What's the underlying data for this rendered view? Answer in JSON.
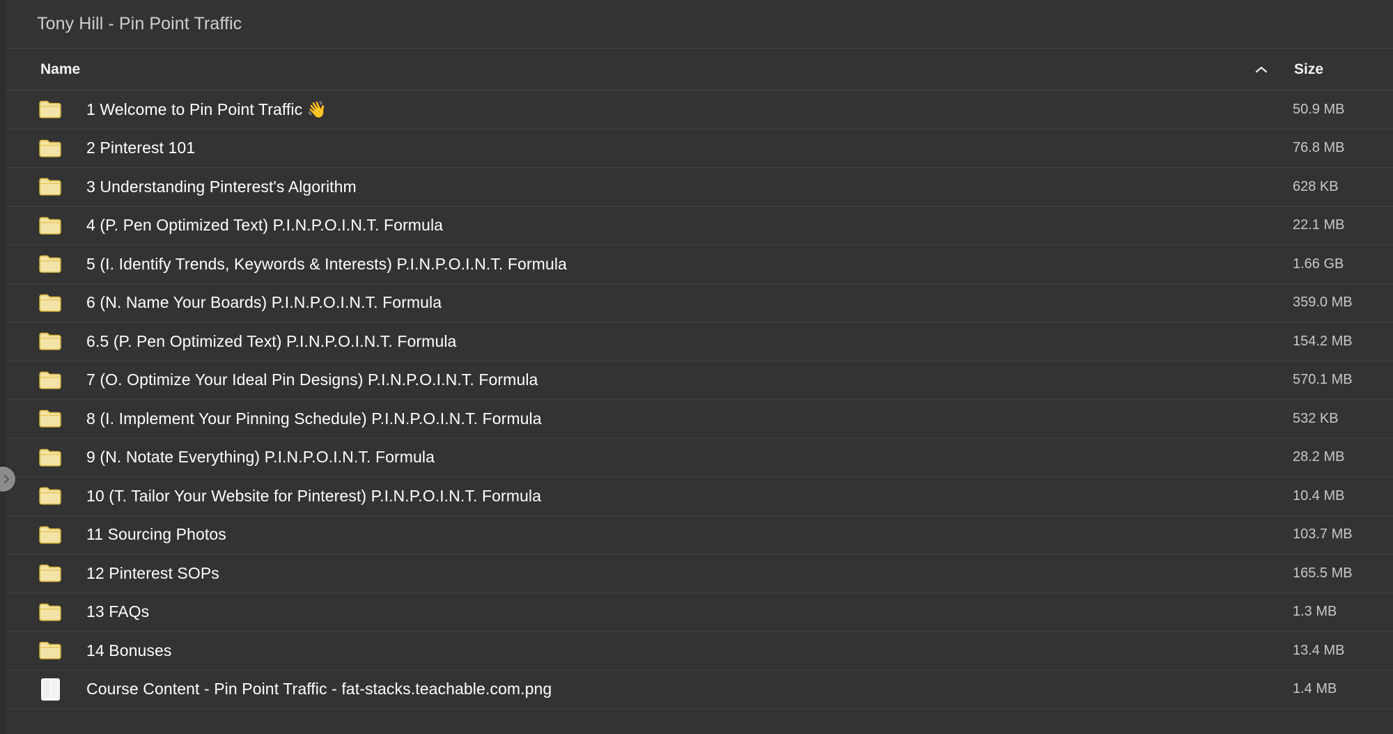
{
  "window": {
    "title": "Tony Hill - Pin Point Traffic"
  },
  "columns": {
    "name_label": "Name",
    "size_label": "Size",
    "sort_column": "Name",
    "sort_direction": "ascending",
    "sort_icon": "chevron-up-icon"
  },
  "sidebar_handle": {
    "icon": "chevron-right-icon"
  },
  "colors": {
    "background": "#333333",
    "row_divider": "#414141",
    "header_divider": "#4a4a4a",
    "text_primary": "#ffffff",
    "text_secondary": "#c8c8c8",
    "title_text": "#cfcfcf",
    "folder_fill": "#f2e3a8",
    "folder_stroke": "#e0bd44",
    "handle_fill": "#8c8c8c"
  },
  "files": [
    {
      "name": "1 Welcome to Pin Point Traffic 👋",
      "size": "50.9 MB",
      "kind": "folder",
      "icon": "folder-icon"
    },
    {
      "name": "2 Pinterest 101",
      "size": "76.8 MB",
      "kind": "folder",
      "icon": "folder-icon"
    },
    {
      "name": "3 Understanding Pinterest's Algorithm",
      "size": "628 KB",
      "kind": "folder",
      "icon": "folder-icon"
    },
    {
      "name": "4 (P. Pen Optimized Text) P.I.N.P.O.I.N.T. Formula",
      "size": "22.1 MB",
      "kind": "folder",
      "icon": "folder-icon"
    },
    {
      "name": "5 (I. Identify Trends, Keywords & Interests) P.I.N.P.O.I.N.T. Formula",
      "size": "1.66 GB",
      "kind": "folder",
      "icon": "folder-icon"
    },
    {
      "name": "6 (N. Name Your Boards) P.I.N.P.O.I.N.T. Formula",
      "size": "359.0 MB",
      "kind": "folder",
      "icon": "folder-icon"
    },
    {
      "name": "6.5 (P. Pen Optimized Text) P.I.N.P.O.I.N.T. Formula",
      "size": "154.2 MB",
      "kind": "folder",
      "icon": "folder-icon"
    },
    {
      "name": "7 (O. Optimize Your Ideal Pin Designs) P.I.N.P.O.I.N.T. Formula",
      "size": "570.1 MB",
      "kind": "folder",
      "icon": "folder-icon"
    },
    {
      "name": "8 (I. Implement Your Pinning Schedule) P.I.N.P.O.I.N.T. Formula",
      "size": "532 KB",
      "kind": "folder",
      "icon": "folder-icon"
    },
    {
      "name": "9 (N. Notate Everything) P.I.N.P.O.I.N.T. Formula",
      "size": "28.2 MB",
      "kind": "folder",
      "icon": "folder-icon"
    },
    {
      "name": "10 (T. Tailor Your Website for Pinterest) P.I.N.P.O.I.N.T. Formula",
      "size": "10.4 MB",
      "kind": "folder",
      "icon": "folder-icon"
    },
    {
      "name": "11 Sourcing Photos",
      "size": "103.7 MB",
      "kind": "folder",
      "icon": "folder-icon"
    },
    {
      "name": "12 Pinterest SOPs",
      "size": "165.5 MB",
      "kind": "folder",
      "icon": "folder-icon"
    },
    {
      "name": "13 FAQs",
      "size": "1.3 MB",
      "kind": "folder",
      "icon": "folder-icon"
    },
    {
      "name": "14 Bonuses",
      "size": "13.4 MB",
      "kind": "folder",
      "icon": "folder-icon"
    },
    {
      "name": "Course Content - Pin Point Traffic - fat-stacks.teachable.com.png",
      "size": "1.4 MB",
      "kind": "image",
      "icon": "image-thumbnail-icon"
    }
  ]
}
